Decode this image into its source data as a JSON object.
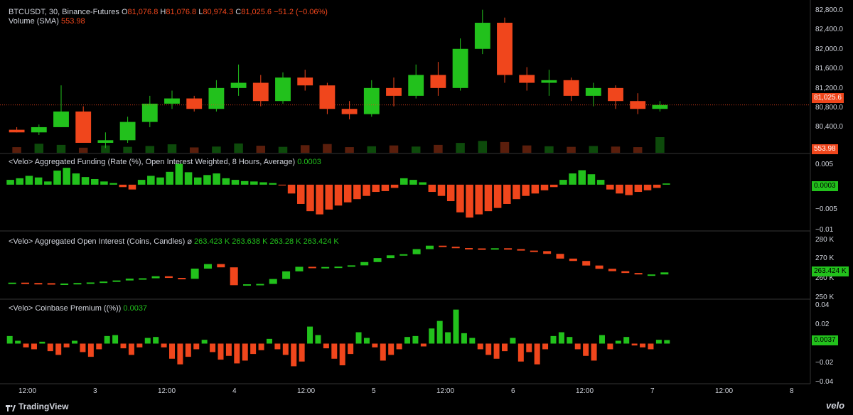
{
  "theme": {
    "green": "#22c11c",
    "red": "#f0461c",
    "grid": "#262626",
    "bg": "#000000"
  },
  "header": {
    "symbol": "BTCUSDT, 30, Binance-Futures",
    "o_label": "O",
    "o_val": "81,076.8",
    "h_label": "H",
    "h_val": "81,076.8",
    "l_label": "L",
    "l_val": "80,974.3",
    "c_label": "C",
    "c_val": "81,025.6",
    "change": "−51.2 (−0.06%)",
    "volume_label": "Volume (SMA)",
    "volume_val": "553.98"
  },
  "indicators": {
    "funding_label": "<Velo> Aggregated Funding (Rate (%), Open Interest Weighted, 8 Hours, Average)",
    "funding_val": "0.0003",
    "oi_label": "<Velo> Aggregated Open Interest (Coins, Candles)",
    "oi_icon": "⌀",
    "oi_vals": [
      "263.423 K",
      "263.638 K",
      "263.28 K",
      "263.424 K"
    ],
    "premium_label": "<Velo> Coinbase Premium ((%))",
    "premium_val": "0.0037"
  },
  "axes": {
    "price_ticks": [
      "82,800.0",
      "82,400.0",
      "82,000.0",
      "81,600.0",
      "81,200.0",
      "80,800.0",
      "80,400.0"
    ],
    "price_badge": "81,025.6",
    "volume_badge": "553.98",
    "funding_ticks": [
      "0.005",
      "−0.005",
      "−0.01"
    ],
    "funding_badge": "0.0003",
    "oi_ticks": [
      "280 K",
      "270 K",
      "260 K",
      "250 K"
    ],
    "oi_badge": "263.424 K",
    "premium_ticks": [
      "0.04",
      "0.02",
      "−0.02",
      "−0.04"
    ],
    "premium_badge": "0.0037",
    "time_ticks": [
      "12:00",
      "3",
      "12:00",
      "4",
      "12:00",
      "5",
      "12:00",
      "6",
      "12:00",
      "7",
      "12:00",
      "8"
    ]
  },
  "branding": {
    "tradingview": "TradingView",
    "velo": "velo"
  },
  "chart_data": [
    {
      "type": "candlestick",
      "title": "BTCUSDT, 30, Binance-Futures",
      "ylim": [
        80150,
        82900
      ],
      "candles": [
        [
          80550,
          80600,
          80500,
          80500
        ],
        [
          80500,
          80650,
          80450,
          80600
        ],
        [
          80600,
          81400,
          80600,
          80900
        ],
        [
          80900,
          81000,
          80400,
          80300
        ],
        [
          80300,
          80500,
          80200,
          80350
        ],
        [
          80350,
          80800,
          80300,
          80700
        ],
        [
          80700,
          81200,
          80600,
          81050
        ],
        [
          81050,
          81300,
          80950,
          81150
        ],
        [
          81150,
          81200,
          80900,
          80950
        ],
        [
          80950,
          81500,
          80900,
          81350
        ],
        [
          81350,
          81800,
          81200,
          81450
        ],
        [
          81450,
          81600,
          81000,
          81100
        ],
        [
          81100,
          81650,
          81050,
          81550
        ],
        [
          81550,
          81700,
          81300,
          81400
        ],
        [
          81400,
          81450,
          80850,
          80950
        ],
        [
          80950,
          81100,
          80750,
          80850
        ],
        [
          80850,
          81500,
          80800,
          81350
        ],
        [
          81350,
          81550,
          81000,
          81200
        ],
        [
          81200,
          81800,
          81150,
          81600
        ],
        [
          81600,
          81850,
          81200,
          81350
        ],
        [
          81350,
          82300,
          81300,
          82100
        ],
        [
          82100,
          82850,
          82000,
          82600
        ],
        [
          82600,
          82700,
          81450,
          81600
        ],
        [
          81600,
          81750,
          81300,
          81450
        ],
        [
          81450,
          81700,
          81200,
          81500
        ],
        [
          81500,
          81550,
          81100,
          81200
        ],
        [
          81200,
          81450,
          81000,
          81350
        ],
        [
          81350,
          81400,
          80950,
          81100
        ],
        [
          81100,
          81250,
          80850,
          80950
        ],
        [
          80950,
          81100,
          80900,
          81025.6
        ]
      ],
      "volume": [
        200,
        320,
        280,
        180,
        260,
        210,
        240,
        300,
        190,
        220,
        330,
        250,
        210,
        270,
        310,
        200,
        230,
        260,
        220,
        280,
        350,
        420,
        380,
        260,
        230,
        210,
        240,
        220,
        200,
        553.98
      ]
    },
    {
      "type": "bar",
      "title": "<Velo> Aggregated Funding (Rate (%), Open Interest Weighted, 8 Hours, Average)",
      "ylim": [
        -0.011,
        0.006
      ],
      "values": [
        0.0012,
        0.0016,
        0.0022,
        0.0018,
        0.0008,
        0.0035,
        0.0042,
        0.0028,
        0.0019,
        0.0014,
        0.0008,
        0.0004,
        -0.0006,
        -0.0012,
        0.0012,
        0.0022,
        0.0018,
        0.0032,
        0.0052,
        0.0031,
        0.0018,
        0.0024,
        0.0028,
        0.0016,
        0.0012,
        0.0009,
        0.0008,
        0.0006,
        0.0004,
        -0.0002,
        -0.0022,
        -0.0048,
        -0.0066,
        -0.0074,
        -0.0062,
        -0.0052,
        -0.0044,
        -0.0036,
        -0.0028,
        -0.0018,
        -0.0016,
        -0.0008,
        0.0016,
        0.0012,
        0.0006,
        -0.0018,
        -0.0028,
        -0.0041,
        -0.0069,
        -0.0082,
        -0.0074,
        -0.0066,
        -0.0058,
        -0.0048,
        -0.0036,
        -0.0028,
        -0.0022,
        -0.0014,
        -0.0006,
        0.0012,
        0.0028,
        0.0036,
        0.0026,
        0.0012,
        -0.0012,
        -0.0022,
        -0.0026,
        -0.0018,
        -0.0014,
        -0.0008,
        0.0003
      ]
    },
    {
      "type": "candlestick",
      "title": "<Velo> Aggregated Open Interest (Coins, Candles)",
      "ylim": [
        249500,
        281500
      ],
      "values": [
        257800,
        257600,
        257500,
        256900,
        257300,
        257600,
        257900,
        258400,
        259000,
        260000,
        260200,
        261300,
        260400,
        259900,
        265500,
        268000,
        266200,
        256400,
        256900,
        257100,
        259800,
        264000,
        266500,
        266400,
        266400,
        266600,
        267300,
        269100,
        271300,
        272800,
        273400,
        276200,
        278100,
        277500,
        276800,
        276600,
        276300,
        276700,
        276200,
        275400,
        275100,
        273600,
        271000,
        269700,
        267200,
        265400,
        264100,
        263100,
        262300,
        262300,
        263424
      ]
    },
    {
      "type": "bar",
      "title": "<Velo> Coinbase Premium ((%))",
      "ylim": [
        -0.041,
        0.041
      ],
      "values": [
        0.008,
        0.003,
        -0.004,
        -0.006,
        0.002,
        -0.008,
        -0.012,
        -0.004,
        0.003,
        -0.009,
        -0.014,
        -0.006,
        0.008,
        0.009,
        -0.005,
        -0.012,
        -0.004,
        0.006,
        0.007,
        -0.004,
        -0.016,
        -0.022,
        -0.014,
        -0.006,
        0.004,
        -0.009,
        -0.017,
        -0.013,
        -0.021,
        -0.018,
        -0.011,
        -0.007,
        0.005,
        -0.006,
        -0.012,
        -0.024,
        -0.019,
        0.018,
        0.009,
        -0.005,
        -0.016,
        -0.023,
        -0.011,
        0.012,
        0.006,
        -0.004,
        -0.018,
        -0.012,
        -0.006,
        0.007,
        0.008,
        -0.003,
        0.016,
        0.024,
        0.012,
        0.036,
        0.011,
        0.006,
        -0.006,
        -0.012,
        -0.016,
        -0.008,
        0.006,
        -0.019,
        -0.009,
        -0.022,
        -0.006,
        0.008,
        0.012,
        0.007,
        -0.006,
        -0.013,
        -0.018,
        0.009,
        -0.006,
        0.003,
        0.007,
        -0.002,
        -0.004,
        -0.006,
        0.004,
        0.0037
      ]
    }
  ]
}
